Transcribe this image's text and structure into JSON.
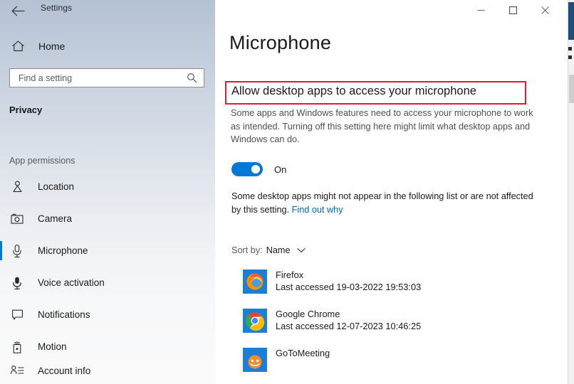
{
  "window": {
    "title": "Settings",
    "back_icon": "back-arrow-icon",
    "controls": {
      "minimize": "minimize-icon",
      "maximize": "maximize-icon",
      "close": "close-icon"
    }
  },
  "sidebar": {
    "home": {
      "label": "Home",
      "icon": "home-icon"
    },
    "search": {
      "placeholder": "Find a setting",
      "value": "",
      "icon": "search-icon"
    },
    "section_title": "Privacy",
    "group_label": "App permissions",
    "items": [
      {
        "label": "Location",
        "icon": "location-icon",
        "selected": false
      },
      {
        "label": "Camera",
        "icon": "camera-icon",
        "selected": false
      },
      {
        "label": "Microphone",
        "icon": "microphone-icon",
        "selected": true
      },
      {
        "label": "Voice activation",
        "icon": "voice-activation-icon",
        "selected": false
      },
      {
        "label": "Notifications",
        "icon": "notifications-icon",
        "selected": false
      },
      {
        "label": "Motion",
        "icon": "motion-icon",
        "selected": false
      },
      {
        "label": "Account info",
        "icon": "account-info-icon",
        "selected": false
      }
    ]
  },
  "main": {
    "page_title": "Microphone",
    "setting": {
      "heading": "Allow desktop apps to access your microphone",
      "highlighted": true,
      "highlight_color": "#e8192c",
      "description": "Some apps and Windows features need to access your microphone to work as intended. Turning off this setting here might limit what desktop apps and Windows can do.",
      "toggle": {
        "state": "On",
        "label": "On",
        "accent_color": "#0078d4"
      }
    },
    "note": {
      "text": "Some desktop apps might not appear in the following list or are not affected by this setting. ",
      "link_text": "Find out why",
      "link_color": "#0067c0"
    },
    "sort": {
      "label": "Sort by:",
      "value": "Name",
      "chevron_icon": "chevron-down-icon"
    },
    "apps": [
      {
        "name": "Firefox",
        "meta": "Last accessed 19-03-2022 19:53:03",
        "icon": "firefox-icon"
      },
      {
        "name": "Google Chrome",
        "meta": "Last accessed 12-07-2023 10:46:25",
        "icon": "chrome-icon"
      },
      {
        "name": "GoToMeeting",
        "meta": "",
        "icon": "gotomeeting-icon"
      }
    ]
  }
}
